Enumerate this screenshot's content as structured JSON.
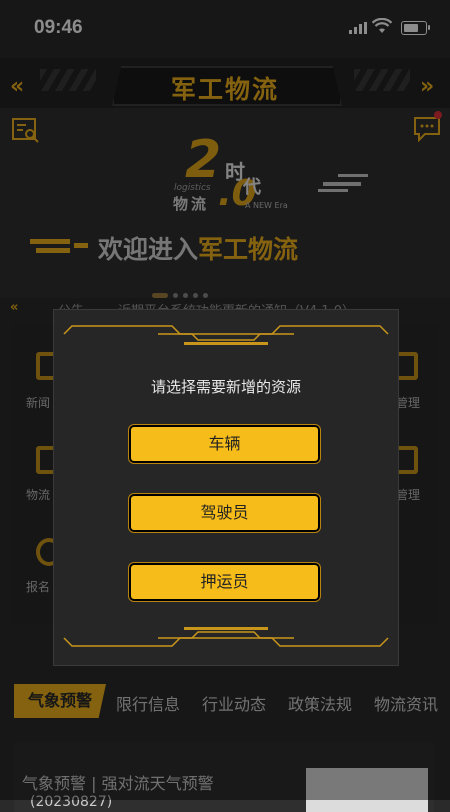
{
  "status_bar": {
    "time": "09:46"
  },
  "header": {
    "title": "军工物流"
  },
  "banner": {
    "logo_2": "2",
    "logo_0": ".0",
    "logo_shi": "时",
    "logo_dai": "代",
    "logo_en": "logistics",
    "logo_wuliu": "物流",
    "logo_era": "A NEW Era",
    "welcome_prefix": "欢迎进入",
    "welcome_brand": "军工物流",
    "slide_count": 5,
    "active_slide": 1
  },
  "notice": {
    "label": "公告",
    "text": "近期平台系统功能更新的通知（V4.1.0）"
  },
  "grid": {
    "items": [
      "新闻",
      "管理",
      "物流",
      "管理",
      "报名"
    ]
  },
  "dialog": {
    "title": "请选择需要新增的资源",
    "options": [
      "车辆",
      "驾驶员",
      "押运员"
    ]
  },
  "tabs": [
    "气象预警",
    "限行信息",
    "行业动态",
    "政策法规",
    "物流资讯"
  ],
  "card": {
    "title": "气象预警 | 强对流天气预警",
    "date": "(20230827)"
  },
  "colors": {
    "accent": "#f0b21c",
    "background": "#2a2a2a",
    "alert": "#e0303a"
  }
}
